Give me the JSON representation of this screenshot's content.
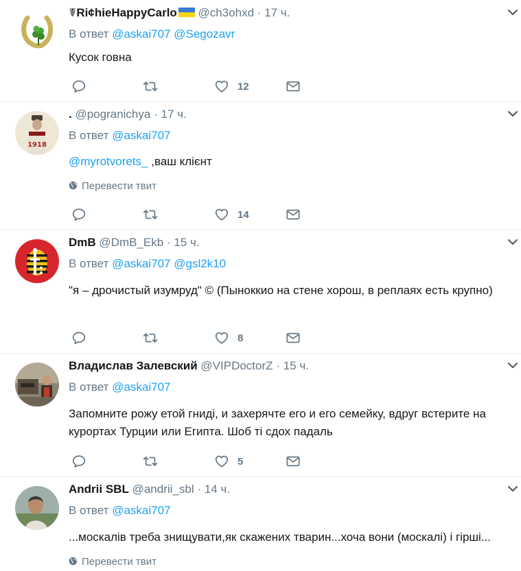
{
  "tweets": [
    {
      "name": "☤Ri¢hieHappyCarlo",
      "handle": "@ch3ohxd",
      "time": "17 ч.",
      "reply_prefix": "В ответ",
      "reply_to": [
        "@askai707",
        "@Segozavr"
      ],
      "text": "Кусок говна",
      "likes": "12"
    },
    {
      "name": ".",
      "handle": "@pogranichya",
      "time": "17 ч.",
      "reply_prefix": "В ответ",
      "reply_to": [
        "@askai707"
      ],
      "mention": "@myrotvorets_",
      "text": " ,ваш клієнт",
      "translate": "Перевести твит",
      "likes": "14",
      "avatar_text": "1918"
    },
    {
      "name": "DmB",
      "handle": "@DmB_Ekb",
      "time": "15 ч.",
      "reply_prefix": "В ответ",
      "reply_to": [
        "@askai707",
        "@gsl2k10"
      ],
      "text": "\"я – дрочистый изумруд\" ©  (Пыноккио на стене хорош, в реплаях есть крупно)",
      "likes": "8"
    },
    {
      "name": "Владислав Залевский",
      "handle": "@VIPDoctorZ",
      "time": "15 ч.",
      "reply_prefix": "В ответ",
      "reply_to": [
        "@askai707"
      ],
      "text": "Запомните рожу етой гниді, и захерячте его и его семейку, вдруг встерите на курортах Турции или Египта. Шоб ті сдох падаль",
      "likes": "5"
    },
    {
      "name": "Andrii SBL",
      "handle": "@andrii_sbl",
      "time": "14 ч.",
      "reply_prefix": "В ответ",
      "reply_to": [
        "@askai707"
      ],
      "text": "...москалів треба знищувати,як скажених тварин...хоча вони (москалі) і гірші...",
      "translate": "Перевести твит"
    }
  ],
  "icons": {
    "reply": "reply-icon",
    "retweet": "retweet-icon",
    "like": "heart-icon",
    "dm": "envelope-icon",
    "more": "chevron-down-icon",
    "translate": "globe-icon",
    "flag": "ukraine-flag-icon"
  },
  "colors": {
    "link": "#1da1f2",
    "secondary": "#657786",
    "text": "#14171a",
    "divider": "#e6ecf0"
  }
}
